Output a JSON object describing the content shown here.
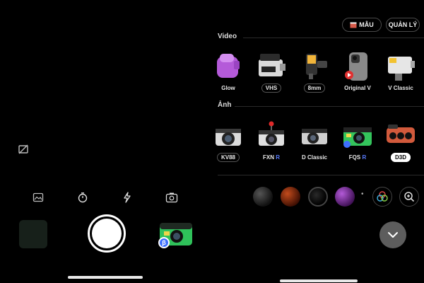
{
  "camera": {
    "icons": [
      "no-flash-frame-icon",
      "gallery-edit-icon",
      "timer-icon",
      "flash-icon",
      "flip-camera-icon"
    ],
    "current_camera_badge": "β"
  },
  "picker": {
    "buttons": {
      "store_label": "MẪU",
      "manage_label": "QUẢN LÝ"
    },
    "video": {
      "section_label": "Video",
      "items": [
        {
          "label": "Glow",
          "style": "plain"
        },
        {
          "label": "VHS",
          "style": "boxed"
        },
        {
          "label": "8mm",
          "style": "boxed"
        },
        {
          "label": "Original V",
          "style": "plain"
        },
        {
          "label": "V Classic",
          "style": "plain"
        }
      ]
    },
    "photo": {
      "section_label": "Ảnh",
      "items": [
        {
          "label": "KV88",
          "style": "boxed",
          "suffix": ""
        },
        {
          "label": "FXN",
          "style": "plain",
          "suffix": "R"
        },
        {
          "label": "D Classic",
          "style": "plain",
          "suffix": ""
        },
        {
          "label": "FQS",
          "style": "plain",
          "suffix": "R"
        },
        {
          "label": "D3D",
          "style": "selected",
          "suffix": ""
        }
      ]
    },
    "filter_dot": "•",
    "colors": {
      "accent": "#5a7dff",
      "selected_bg": "#ffffff"
    }
  }
}
